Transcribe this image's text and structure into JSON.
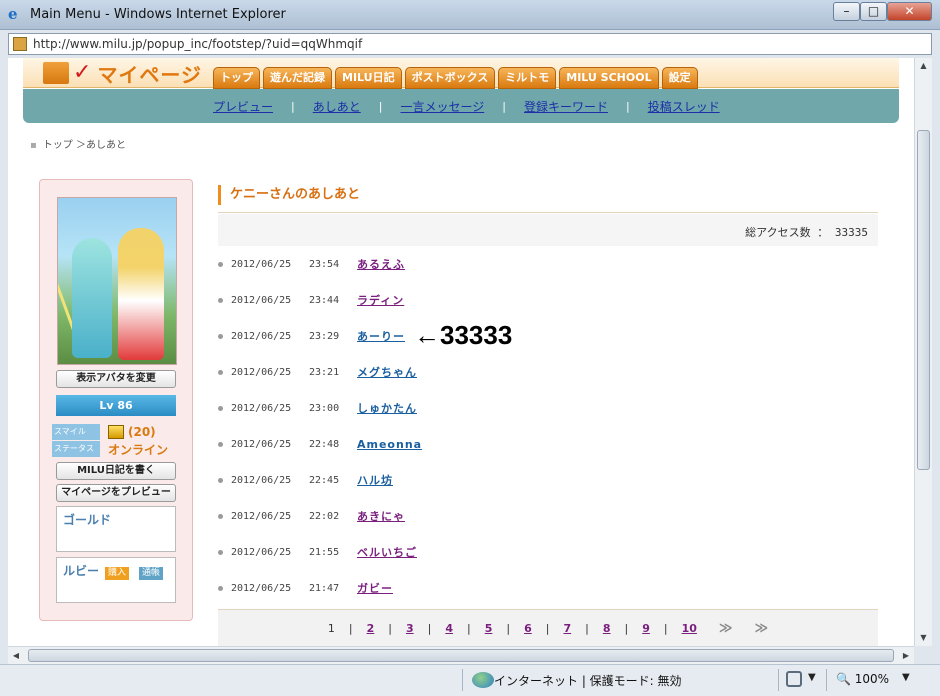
{
  "window": {
    "title": "Main Menu - Windows Internet Explorer",
    "url": "http://www.milu.jp/popup_inc/footstep/?uid=qqWhmqif",
    "min": "–",
    "max": "□",
    "close": "✕"
  },
  "site": {
    "logo_text": "マイページ",
    "tabs": [
      "トップ",
      "遊んだ記録",
      "MILU日記",
      "ポストボックス",
      "ミルトモ",
      "MILU SCHOOL",
      "設定"
    ],
    "subnav": [
      "プレビュー",
      "あしあと",
      "一言メッセージ",
      "登録キーワード",
      "投稿スレッド"
    ],
    "subnav_sep": "|"
  },
  "breadcrumb": {
    "top": "トップ",
    "sep": "＞",
    "current": "あしあと"
  },
  "profile": {
    "change_avatar": "表示アバタを変更",
    "level": "Lv 86",
    "smile_label": "スマイル",
    "smile_value": "(20)",
    "status_label": "ステータス",
    "status_value": "オンライン",
    "write_diary": "MILU日記を書く",
    "preview_page": "マイページをプレビュー",
    "gold_label": "ゴールド",
    "ruby_label": "ルビー",
    "buy_label": "購入",
    "bankbook_label": "通帳"
  },
  "footstep": {
    "title": "ケニーさんのあしあと",
    "access_label": "総アクセス数",
    "access_sep": "：",
    "access_count": "33335",
    "entries": [
      {
        "date": "2012/06/25",
        "time": "23:54",
        "name": "あるえふ"
      },
      {
        "date": "2012/06/25",
        "time": "23:44",
        "name": "ラディン"
      },
      {
        "date": "2012/06/25",
        "time": "23:29",
        "name": "あーりー"
      },
      {
        "date": "2012/06/25",
        "time": "23:21",
        "name": "メグちゃん"
      },
      {
        "date": "2012/06/25",
        "time": "23:00",
        "name": "しゅかたん"
      },
      {
        "date": "2012/06/25",
        "time": "22:48",
        "name": "Ameonna"
      },
      {
        "date": "2012/06/25",
        "time": "22:45",
        "name": "ハル坊"
      },
      {
        "date": "2012/06/25",
        "time": "22:02",
        "name": "あきにゃ"
      },
      {
        "date": "2012/06/25",
        "time": "21:55",
        "name": "ベルいちご"
      },
      {
        "date": "2012/06/25",
        "time": "21:47",
        "name": "ガビー"
      }
    ],
    "annotation": "←33333"
  },
  "pager": {
    "current": "1",
    "pages": [
      "2",
      "3",
      "4",
      "5",
      "6",
      "7",
      "8",
      "9",
      "10"
    ],
    "sep": "|",
    "next": "≫",
    "last": "≫"
  },
  "status": {
    "zone": "インターネット | 保護モード: 無効",
    "zoom": "100%"
  },
  "colors": {
    "accent": "#f08c1c",
    "subnav_bg": "#6fa7aa",
    "link_visited": "#7a1f7e",
    "link": "#1a5fa0"
  }
}
